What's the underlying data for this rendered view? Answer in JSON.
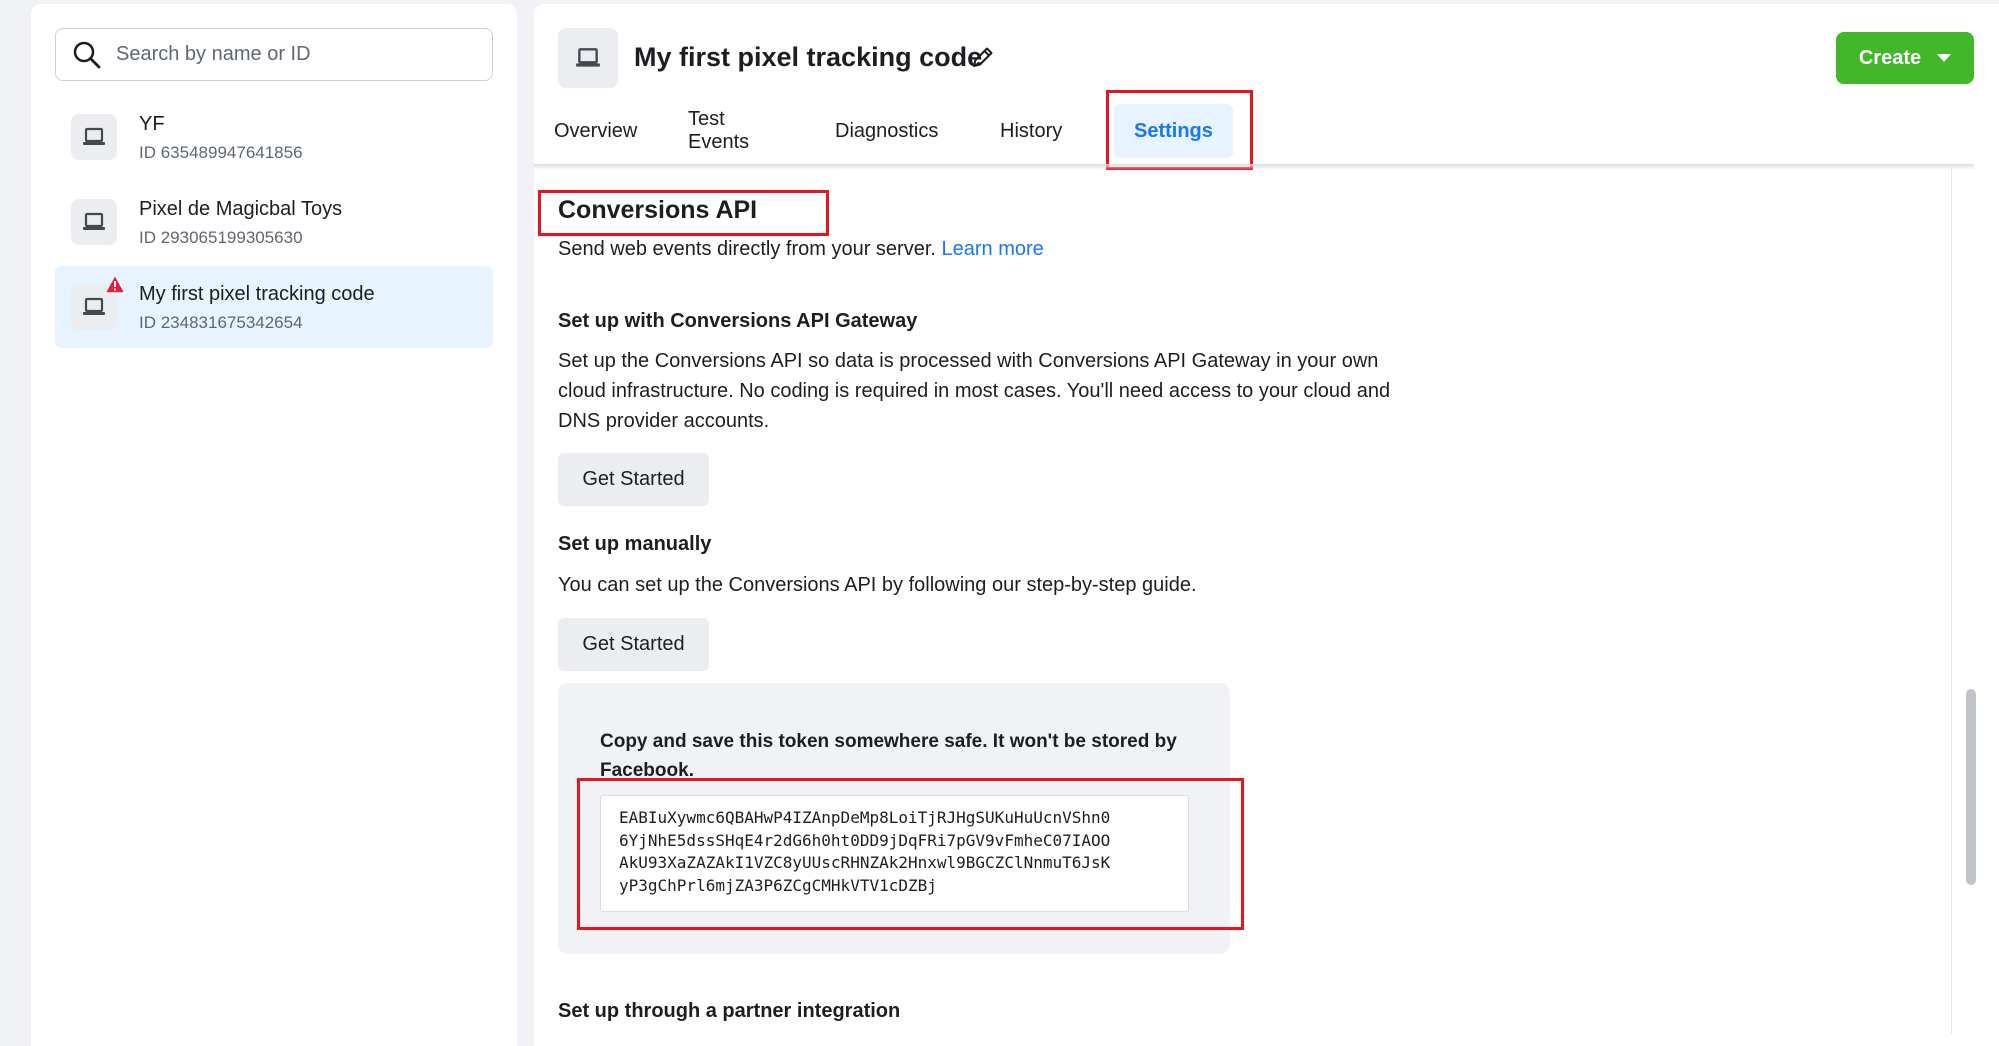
{
  "sidebar": {
    "search_placeholder": "Search by name or ID",
    "items": [
      {
        "name": "YF",
        "id": "ID 635489947641856"
      },
      {
        "name": "Pixel de Magicbal Toys",
        "id": "ID 293065199305630"
      },
      {
        "name": "My first pixel tracking code",
        "id": "ID 234831675342654",
        "selected": true,
        "warning": true
      }
    ]
  },
  "header": {
    "title": "My first pixel tracking code",
    "create_label": "Create",
    "create_color": "#42b72a"
  },
  "tabs": [
    {
      "label": "Overview"
    },
    {
      "label": "Test Events"
    },
    {
      "label": "Diagnostics"
    },
    {
      "label": "History"
    },
    {
      "label": "Settings",
      "active": true
    }
  ],
  "conversions_api": {
    "title": "Conversions API",
    "description": "Send web events directly from your server.",
    "learn_more": "Learn more",
    "gateway": {
      "heading": "Set up with Conversions API Gateway",
      "line1": "Set up the Conversions API so data is processed with Conversions API Gateway in your own",
      "line2": "cloud infrastructure. No coding is required in most cases. You'll need access to your cloud and",
      "line3": "DNS provider accounts.",
      "button": "Get Started"
    },
    "manual": {
      "heading": "Set up manually",
      "text": "You can set up the Conversions API by following our step-by-step guide.",
      "button": "Get Started"
    },
    "token": {
      "message_line1": "Copy and save this token somewhere safe. It won't be stored by",
      "message_line2": "Facebook.",
      "value_line1": "EABIuXywmc6QBAHwP4IZAnpDeMp8LoiTjRJHgSUKuHuUcnVShn0",
      "value_line2": "6YjNhE5dssSHqE4r2dG6h0ht0DD9jDqFRi7pGV9vFmheC07IAOO",
      "value_line3": "AkU93XaZAZAkI1VZC8yUUscRHNZAk2Hnxwl9BGCZClNnmuT6JsK",
      "value_line4": "yP3gChPrl6mjZA3P6ZCgCMHkVTV1cDZBj"
    },
    "partner": {
      "heading": "Set up through a partner integration"
    }
  },
  "colors": {
    "highlight": "#e8141f",
    "accent": "#1877f2",
    "warning": "#e41e3f"
  }
}
